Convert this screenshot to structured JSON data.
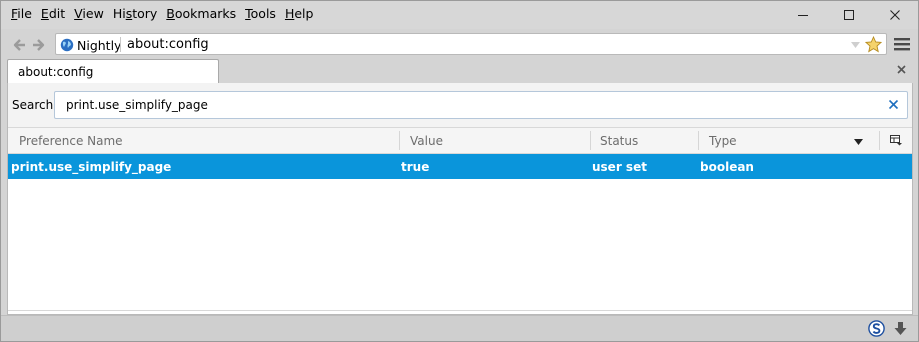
{
  "menubar": {
    "items": [
      {
        "pre": "",
        "acc": "F",
        "post": "ile"
      },
      {
        "pre": "",
        "acc": "E",
        "post": "dit"
      },
      {
        "pre": "",
        "acc": "V",
        "post": "iew"
      },
      {
        "pre": "Hi",
        "acc": "s",
        "post": "tory"
      },
      {
        "pre": "",
        "acc": "B",
        "post": "ookmarks"
      },
      {
        "pre": "",
        "acc": "T",
        "post": "ools"
      },
      {
        "pre": "",
        "acc": "H",
        "post": "elp"
      }
    ]
  },
  "navbar": {
    "identity_label": "Nightly",
    "url": "about:config",
    "icons": [
      "back-arrow-icon",
      "forward-arrow-icon",
      "globe-icon",
      "dropdown-icon",
      "star-icon",
      "hamburger-menu-icon"
    ]
  },
  "tab": {
    "label": "about:config"
  },
  "search": {
    "label": "Search:",
    "value": "print.use_simplify_page"
  },
  "columns": {
    "name": "Preference Name",
    "value": "Value",
    "status": "Status",
    "type": "Type"
  },
  "rows": [
    {
      "name": "print.use_simplify_page",
      "value": "true",
      "status": "user set",
      "type": "boolean"
    }
  ],
  "colors": {
    "selected_row": "#0a95db",
    "chrome": "#d4d4d4",
    "clear_button": "#1f6fbf"
  }
}
